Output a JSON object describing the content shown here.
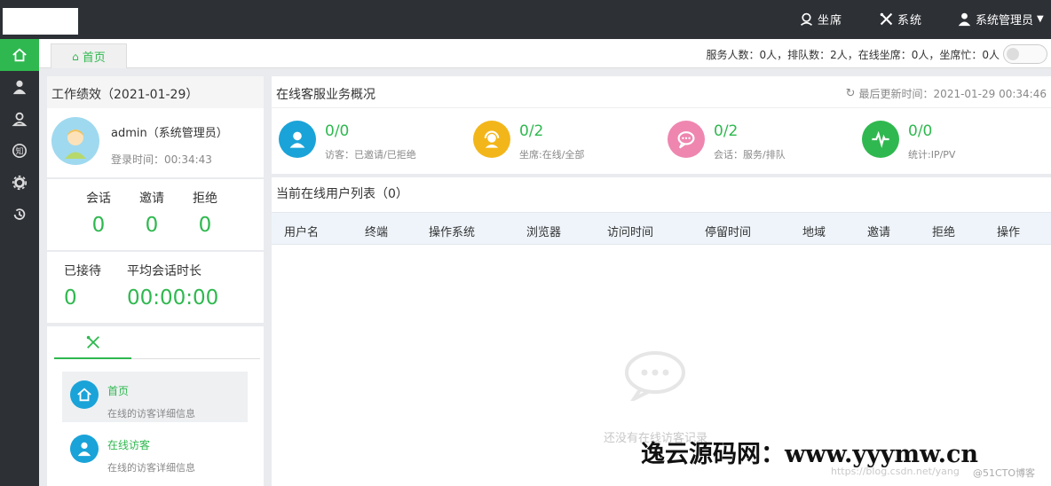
{
  "topbar": {
    "seat_label": "坐席",
    "system_label": "系统",
    "user_label": "系统管理员"
  },
  "tabs": {
    "home_label": "首页"
  },
  "stats_bar": {
    "text": "服务人数：0人，排队数：2人，在线坐席：0人，坐席忙：0人"
  },
  "performance": {
    "title": "工作绩效（2021-01-29）",
    "user_name": "admin（系统管理员）",
    "login_time": "登录时间：00:34:43",
    "metrics": [
      {
        "label": "会话",
        "value": "0"
      },
      {
        "label": "邀请",
        "value": "0"
      },
      {
        "label": "拒绝",
        "value": "0"
      }
    ],
    "received_label": "已接待",
    "received_value": "0",
    "avg_label": "平均会话时长",
    "avg_value": "00:00:00"
  },
  "quick_links": [
    {
      "title": "首页",
      "desc": "在线的访客详细信息"
    },
    {
      "title": "在线访客",
      "desc": "在线的访客详细信息"
    }
  ],
  "overview": {
    "title": "在线客服业务概况",
    "updated": "最后更新时间：2021-01-29 00:34:46",
    "cards": [
      {
        "value": "0/0",
        "label": "访客：已邀请/已拒绝",
        "icon": "visitor-icon",
        "color": "#1aa3d8"
      },
      {
        "value": "0/2",
        "label": "坐席:在线/全部",
        "icon": "agent-icon",
        "color": "#f3b61a"
      },
      {
        "value": "0/2",
        "label": "会话：服务/排队",
        "icon": "chat-icon",
        "color": "#ee86b0"
      },
      {
        "value": "0/0",
        "label": "统计:IP/PV",
        "icon": "pulse-icon",
        "color": "#2fb84f"
      }
    ]
  },
  "user_list": {
    "title": "当前在线用户列表（0）",
    "columns": [
      "用户名",
      "终端",
      "操作系统",
      "浏览器",
      "访问时间",
      "停留时间",
      "地域",
      "邀请",
      "拒绝",
      "操作"
    ],
    "empty_text": "还没有在线访客记录"
  },
  "watermark": {
    "main": "逸云源码网：www.yyymw.cn",
    "url": "https://blog.csdn.net/yang",
    "tag": "@51CTO博客"
  }
}
